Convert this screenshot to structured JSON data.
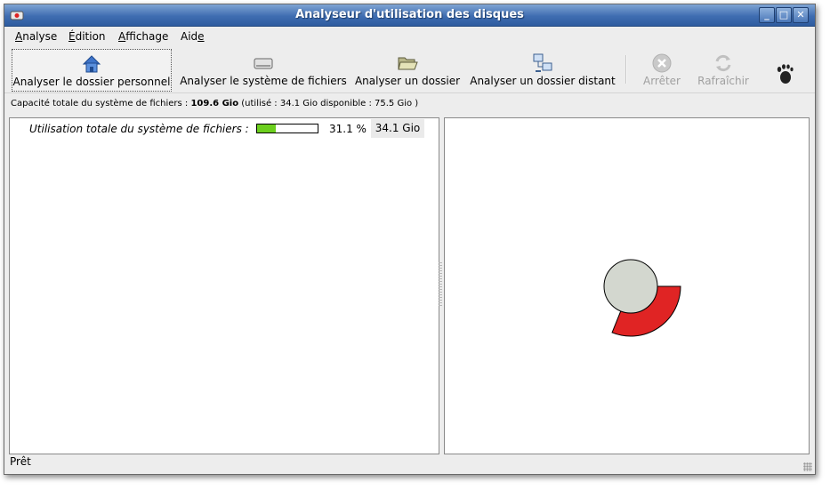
{
  "window": {
    "title": "Analyseur d'utilisation des disques",
    "controls": {
      "minimize": "_",
      "maximize": "□",
      "close": "✕"
    }
  },
  "menu": [
    {
      "pre": "",
      "mnemonic": "A",
      "post": "nalyse"
    },
    {
      "pre": "",
      "mnemonic": "É",
      "post": "dition"
    },
    {
      "pre": "",
      "mnemonic": "A",
      "post": "ffichage"
    },
    {
      "pre": "Aid",
      "mnemonic": "e",
      "post": ""
    }
  ],
  "toolbar": {
    "scan_home": "Analyser le dossier personnel",
    "scan_filesystem": "Analyser le système de fichiers",
    "scan_folder": "Analyser un dossier",
    "scan_remote": "Analyser un dossier distant",
    "stop": "Arrêter",
    "refresh": "Rafraîchir"
  },
  "capacity": {
    "prefix": "Capacité totale du système de fichiers : ",
    "total": "109.6 Gio",
    "details": " (utilisé : 34.1 Gio disponible : 75.5 Gio )"
  },
  "usage": {
    "label": "Utilisation totale du système de fichiers :",
    "fraction": 0.311,
    "percent": "31.1 %",
    "size": "34.1 Gio"
  },
  "ringchart": {
    "used_fraction": 0.311,
    "center_color": "#d3d7cf",
    "segment_color": "#e02424"
  },
  "status": "Prêt",
  "colors": {
    "titlebar": "#3f6db1",
    "progress_fill": "#6ccf1e"
  }
}
